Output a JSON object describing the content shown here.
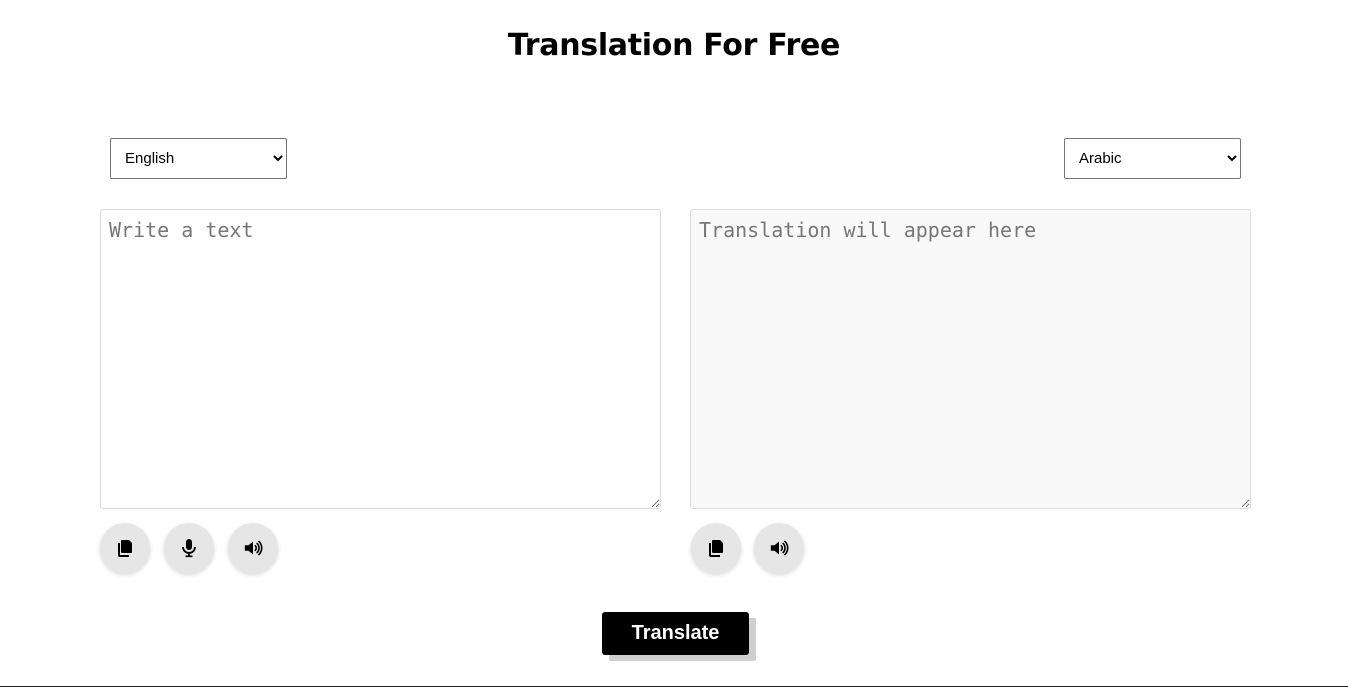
{
  "header": {
    "title": "Translation For Free"
  },
  "source": {
    "language_selected": "English",
    "placeholder": "Write a text",
    "value": "",
    "buttons": {
      "copy_icon": "copy-icon",
      "mic_icon": "microphone-icon",
      "speak_icon": "speaker-icon"
    }
  },
  "target": {
    "language_selected": "Arabic",
    "placeholder": "Translation will appear here",
    "value": "",
    "buttons": {
      "copy_icon": "copy-icon",
      "speak_icon": "speaker-icon"
    }
  },
  "actions": {
    "translate_label": "Translate"
  },
  "colors": {
    "primary_button": "#000000",
    "icon_button_bg": "#e6e6e6",
    "target_textarea_bg": "#f9f9f9"
  }
}
